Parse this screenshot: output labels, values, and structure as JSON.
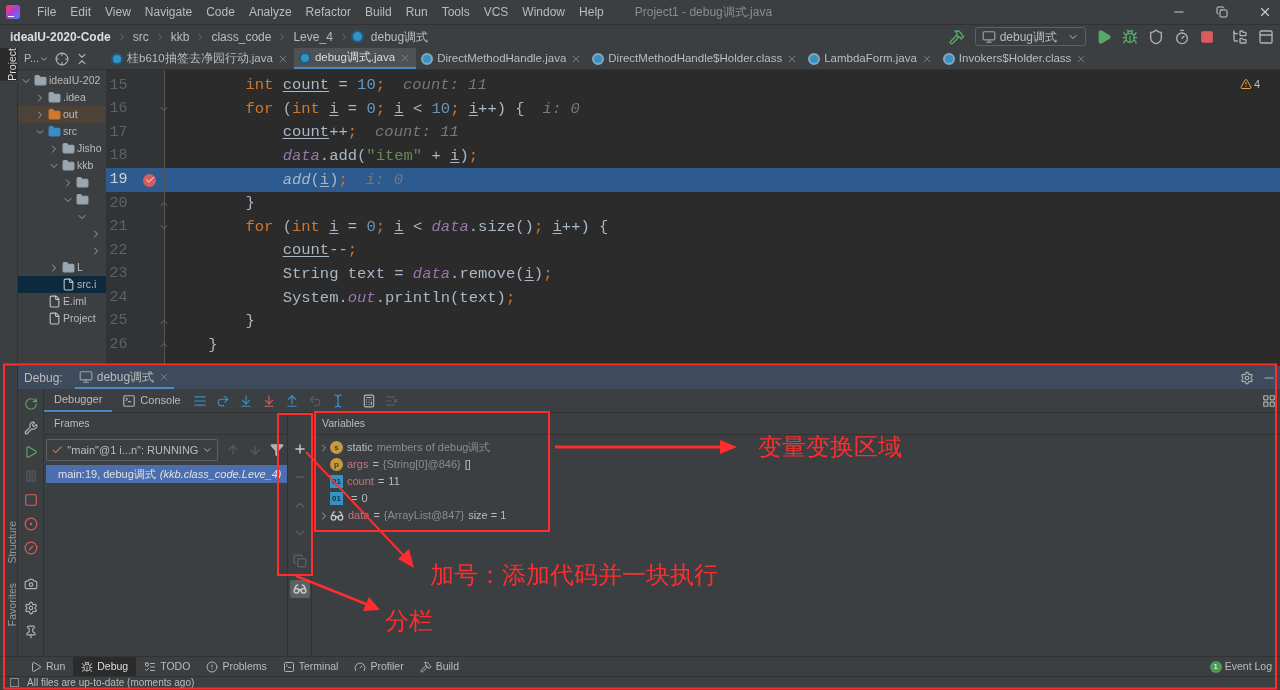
{
  "menu_bar": {
    "items": [
      "File",
      "Edit",
      "View",
      "Navigate",
      "Code",
      "Analyze",
      "Refactor",
      "Build",
      "Run",
      "Tools",
      "VCS",
      "Window",
      "Help"
    ],
    "window_title": "Project1 - debug调式.java"
  },
  "breadcrumb": [
    {
      "label": "ideaIU-2020-Code",
      "kind": "project"
    },
    {
      "label": "src",
      "kind": "folder"
    },
    {
      "label": "kkb",
      "kind": "folder"
    },
    {
      "label": "class_code",
      "kind": "folder"
    },
    {
      "label": "Leve_4",
      "kind": "folder"
    },
    {
      "label": "debug调式",
      "kind": "class"
    }
  ],
  "run_configuration": {
    "label": "debug调式"
  },
  "side_strip": [
    {
      "label": "Project",
      "selected": true
    },
    {
      "label": "Structure",
      "selected": false
    },
    {
      "label": "Favorites",
      "selected": false
    }
  ],
  "project_panel": {
    "title": "P...",
    "tree": [
      {
        "name": "ideaIU-202",
        "kind": "module",
        "expanded": true,
        "selected": false,
        "children": [
          {
            "name": ".idea",
            "kind": "folder",
            "expanded": false,
            "selected": false
          },
          {
            "name": "out",
            "kind": "excluded",
            "expanded": false,
            "selected": false
          },
          {
            "name": "src",
            "kind": "source",
            "expanded": true,
            "selected": false,
            "children": [
              {
                "name": "Jisho",
                "kind": "package",
                "expanded": false,
                "selected": false
              },
              {
                "name": "kkb",
                "kind": "package",
                "expanded": true,
                "selected": false,
                "children": [
                  {
                    "kind": "package",
                    "expanded": false,
                    "selected": false
                  },
                  {
                    "kind": "package",
                    "expanded": true,
                    "selected": false,
                    "children": [
                      {
                        "expanded": true,
                        "selected": false,
                        "children": [
                          {
                            "expanded": false,
                            "selected": false
                          },
                          {
                            "expanded": false,
                            "selected": false
                          }
                        ]
                      }
                    ]
                  }
                ]
              },
              {
                "name": "L",
                "kind": "package",
                "expanded": false,
                "selected": false
              },
              {
                "name": "src.i",
                "kind": "file",
                "selected": true
              }
            ]
          },
          {
            "name": "E.iml",
            "kind": "file",
            "selected": false
          },
          {
            "name": "Project",
            "kind": "file",
            "selected": false
          }
        ]
      }
    ]
  },
  "editor_tabs": [
    {
      "label": "桂b610抽签去净园行动.java",
      "kind": "java",
      "selected": false
    },
    {
      "label": "debug调式.java",
      "kind": "java",
      "selected": true
    },
    {
      "label": "DirectMethodHandle.java",
      "kind": "library",
      "selected": false
    },
    {
      "label": "DirectMethodHandle$Holder.class",
      "kind": "library",
      "selected": false
    },
    {
      "label": "LambdaForm.java",
      "kind": "library",
      "selected": false
    },
    {
      "label": "Invokers$Holder.class",
      "kind": "library",
      "selected": false
    }
  ],
  "editor": {
    "warning_count": "4",
    "lines": [
      {
        "number": "15",
        "current": false,
        "breakpoint": false,
        "fold_start": false,
        "fold_end": false,
        "hint": "count: 11",
        "tokens": [
          {
            "text": "        int ",
            "kind": "keyword"
          },
          {
            "text": "count",
            "kind": "var"
          },
          {
            "text": " = ",
            "kind": "plain"
          },
          {
            "text": "10",
            "kind": "number"
          },
          {
            "text": ";",
            "kind": "keyword"
          }
        ]
      },
      {
        "number": "16",
        "current": false,
        "breakpoint": false,
        "fold_start": true,
        "fold_end": false,
        "hint": "i: 0",
        "tokens": [
          {
            "text": "        for",
            "kind": "keyword"
          },
          {
            "text": " (",
            "kind": "plain"
          },
          {
            "text": "int ",
            "kind": "keyword"
          },
          {
            "text": "i",
            "kind": "var"
          },
          {
            "text": " = ",
            "kind": "plain"
          },
          {
            "text": "0",
            "kind": "number"
          },
          {
            "text": "; ",
            "kind": "keyword"
          },
          {
            "text": "i",
            "kind": "var"
          },
          {
            "text": " < ",
            "kind": "plain"
          },
          {
            "text": "10",
            "kind": "number"
          },
          {
            "text": "; ",
            "kind": "keyword"
          },
          {
            "text": "i",
            "kind": "var"
          },
          {
            "text": "++) {",
            "kind": "plain"
          }
        ]
      },
      {
        "number": "17",
        "current": false,
        "breakpoint": false,
        "fold_start": false,
        "fold_end": false,
        "hint": "count: 11",
        "tokens": [
          {
            "text": "            count",
            "kind": "var"
          },
          {
            "text": "++",
            "kind": "plain"
          },
          {
            "text": ";",
            "kind": "keyword"
          }
        ]
      },
      {
        "number": "18",
        "current": false,
        "breakpoint": false,
        "fold_start": false,
        "fold_end": false,
        "tokens": [
          {
            "text": "            data",
            "kind": "field"
          },
          {
            "text": ".add(",
            "kind": "plain"
          },
          {
            "text": "\"item\"",
            "kind": "string"
          },
          {
            "text": " + ",
            "kind": "plain"
          },
          {
            "text": "i",
            "kind": "var"
          },
          {
            "text": ")",
            "kind": "plain"
          },
          {
            "text": ";",
            "kind": "keyword"
          }
        ]
      },
      {
        "number": "19",
        "current": true,
        "breakpoint": true,
        "fold_start": false,
        "fold_end": false,
        "hint": "i: 0",
        "tokens": [
          {
            "text": "            add",
            "kind": "call"
          },
          {
            "text": "(",
            "kind": "plain"
          },
          {
            "text": "i",
            "kind": "var"
          },
          {
            "text": ")",
            "kind": "plain"
          },
          {
            "text": ";",
            "kind": "keyword"
          }
        ]
      },
      {
        "number": "20",
        "current": false,
        "breakpoint": false,
        "fold_start": false,
        "fold_end": true,
        "tokens": [
          {
            "text": "        }",
            "kind": "plain"
          }
        ]
      },
      {
        "number": "21",
        "current": false,
        "breakpoint": false,
        "fold_start": true,
        "fold_end": false,
        "tokens": [
          {
            "text": "        for",
            "kind": "keyword"
          },
          {
            "text": " (",
            "kind": "plain"
          },
          {
            "text": "int ",
            "kind": "keyword"
          },
          {
            "text": "i",
            "kind": "var"
          },
          {
            "text": " = ",
            "kind": "plain"
          },
          {
            "text": "0",
            "kind": "number"
          },
          {
            "text": "; ",
            "kind": "keyword"
          },
          {
            "text": "i",
            "kind": "var"
          },
          {
            "text": " < ",
            "kind": "plain"
          },
          {
            "text": "data",
            "kind": "field"
          },
          {
            "text": ".size()",
            "kind": "plain"
          },
          {
            "text": "; ",
            "kind": "keyword"
          },
          {
            "text": "i",
            "kind": "var"
          },
          {
            "text": "++) {",
            "kind": "plain"
          }
        ]
      },
      {
        "number": "22",
        "current": false,
        "breakpoint": false,
        "fold_start": false,
        "fold_end": false,
        "tokens": [
          {
            "text": "            count",
            "kind": "var"
          },
          {
            "text": "--",
            "kind": "plain"
          },
          {
            "text": ";",
            "kind": "keyword"
          }
        ]
      },
      {
        "number": "23",
        "current": false,
        "breakpoint": false,
        "fold_start": false,
        "fold_end": false,
        "tokens": [
          {
            "text": "            String text = ",
            "kind": "plain"
          },
          {
            "text": "data",
            "kind": "field"
          },
          {
            "text": ".remove(",
            "kind": "plain"
          },
          {
            "text": "i",
            "kind": "var"
          },
          {
            "text": ")",
            "kind": "plain"
          },
          {
            "text": ";",
            "kind": "keyword"
          }
        ]
      },
      {
        "number": "24",
        "current": false,
        "breakpoint": false,
        "fold_start": false,
        "fold_end": false,
        "tokens": [
          {
            "text": "            System.",
            "kind": "plain"
          },
          {
            "text": "out",
            "kind": "field"
          },
          {
            "text": ".println(text)",
            "kind": "plain"
          },
          {
            "text": ";",
            "kind": "keyword"
          }
        ]
      },
      {
        "number": "25",
        "current": false,
        "breakpoint": false,
        "fold_start": false,
        "fold_end": true,
        "tokens": [
          {
            "text": "        }",
            "kind": "plain"
          }
        ]
      },
      {
        "number": "26",
        "current": false,
        "breakpoint": false,
        "fold_start": false,
        "fold_end": true,
        "tokens": [
          {
            "text": "    }",
            "kind": "plain"
          }
        ]
      }
    ]
  },
  "debug": {
    "title": "Debug:",
    "session_tab": {
      "label": "debug调式"
    },
    "actions": [
      {
        "kind": "rerun",
        "disabled": false
      },
      {
        "kind": "settings-wrench",
        "disabled": false
      },
      {
        "kind": "resume",
        "disabled": false
      },
      {
        "kind": "pause",
        "disabled": true
      },
      {
        "kind": "stop",
        "disabled": false
      },
      {
        "kind": "breakpoints",
        "disabled": false
      },
      {
        "kind": "mute",
        "disabled": false
      },
      {
        "kind": "camera",
        "disabled": false
      },
      {
        "kind": "gear",
        "disabled": false
      },
      {
        "kind": "pin",
        "disabled": false
      }
    ],
    "tabs": [
      {
        "label": "Debugger",
        "kind": "debugger",
        "selected": true
      },
      {
        "label": "Console",
        "kind": "console",
        "selected": false
      }
    ],
    "toolbar": [
      {
        "kind": "threads",
        "disabled": false
      },
      {
        "kind": "step-over",
        "disabled": false
      },
      {
        "kind": "step-into",
        "disabled": false
      },
      {
        "kind": "force-step-into",
        "disabled": false
      },
      {
        "kind": "step-out",
        "disabled": false
      },
      {
        "kind": "drop-frame",
        "disabled": true
      },
      {
        "kind": "run-to-cursor",
        "disabled": false
      },
      {
        "kind": "evaluate",
        "disabled": false
      },
      {
        "kind": "trace",
        "disabled": true
      }
    ],
    "frames": {
      "header": "Frames",
      "thread": "\"main\"@1 i...n\": RUNNING",
      "items": [
        {
          "text": "main:19, debug调式",
          "location": "(kkb.class_code.Leve_4)",
          "selected": true
        }
      ]
    },
    "watch_toolbar": [
      {
        "kind": "add",
        "disabled": false,
        "selected": false
      },
      {
        "kind": "remove",
        "disabled": true,
        "selected": false
      },
      {
        "kind": "up",
        "disabled": true,
        "selected": false
      },
      {
        "kind": "down",
        "disabled": true,
        "selected": false
      },
      {
        "kind": "copy",
        "disabled": true,
        "selected": false
      },
      {
        "kind": "watches",
        "disabled": false,
        "selected": true
      }
    ],
    "variables": {
      "header": "Variables",
      "items": [
        {
          "badge": "s",
          "kind": "static",
          "name": "static",
          "expandable": true,
          "value": [
            {
              "text": "members of debug调式",
              "kind": "ref"
            }
          ]
        },
        {
          "badge": "p",
          "kind": "param",
          "name": "args",
          "separator": "=",
          "expandable": false,
          "value": [
            {
              "text": "{String[0]@846}",
              "kind": "ref"
            },
            {
              "text": "[]",
              "kind": "plain"
            }
          ]
        },
        {
          "badge": "01",
          "kind": "local",
          "name": "count",
          "separator": "=",
          "expandable": false,
          "value": [
            {
              "text": "11",
              "kind": "plain"
            }
          ]
        },
        {
          "badge": "01",
          "kind": "local",
          "separator": "=",
          "expandable": false,
          "value": [
            {
              "text": "0",
              "kind": "plain"
            }
          ]
        },
        {
          "kind": "watch",
          "name": "data",
          "separator": "=",
          "expandable": true,
          "value": [
            {
              "text": "{ArrayList@847}",
              "kind": "ref"
            },
            {
              "text": "size = 1",
              "kind": "plain"
            }
          ]
        }
      ]
    }
  },
  "bottom_tabs": [
    {
      "label": "Run",
      "kind": "run",
      "selected": false
    },
    {
      "label": "Debug",
      "kind": "debug",
      "selected": true
    },
    {
      "label": "TODO",
      "kind": "todo",
      "selected": false
    },
    {
      "label": "Problems",
      "kind": "problems",
      "selected": false
    },
    {
      "label": "Terminal",
      "kind": "terminal",
      "selected": false
    },
    {
      "label": "Profiler",
      "kind": "profiler",
      "selected": false
    },
    {
      "label": "Build",
      "kind": "build",
      "selected": false
    }
  ],
  "event_log": {
    "label": "Event Log",
    "count": "1"
  },
  "status_bar": {
    "message": "All files are up-to-date (moments ago)"
  },
  "annotations": [
    "变量变换区域",
    "加号：添加代码并一块执行",
    "分栏"
  ]
}
